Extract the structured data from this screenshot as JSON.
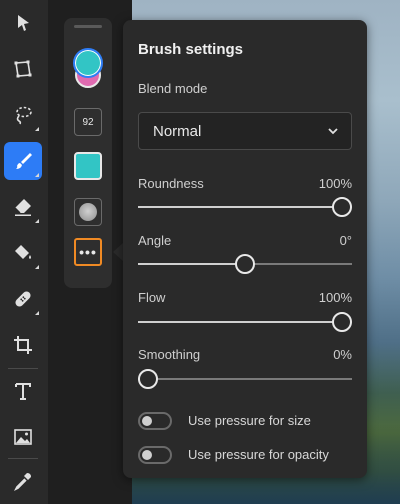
{
  "tool_rail": {
    "tools": [
      {
        "name": "select-tool",
        "icon": "arrow-pointer-icon"
      },
      {
        "name": "transform-tool",
        "icon": "transform-icon"
      },
      {
        "name": "lasso-tool",
        "icon": "lasso-icon"
      },
      {
        "name": "brush-tool",
        "icon": "brush-icon",
        "active": true
      },
      {
        "name": "eraser-tool",
        "icon": "eraser-icon"
      },
      {
        "name": "fill-tool",
        "icon": "paint-bucket-icon"
      },
      {
        "name": "healing-tool",
        "icon": "bandage-icon"
      },
      {
        "name": "crop-tool",
        "icon": "crop-icon"
      },
      {
        "name": "type-tool",
        "icon": "text-icon"
      },
      {
        "name": "image-tool",
        "icon": "image-icon"
      },
      {
        "name": "eyedropper-tool",
        "icon": "eyedropper-icon"
      }
    ],
    "active_color": "#2d7cf6"
  },
  "options": {
    "brush_size": "92",
    "primary_color": "#32c5c5",
    "secondary_color": "#e06ab0",
    "more_icon_text": "•••",
    "highlight_color": "#f08a24"
  },
  "brush_settings": {
    "title": "Brush settings",
    "blend_mode_label": "Blend mode",
    "blend_mode_value": "Normal",
    "roundness": {
      "label": "Roundness",
      "value_text": "100%",
      "value": 100
    },
    "angle": {
      "label": "Angle",
      "value_text": "0°",
      "value": 0,
      "min": -180,
      "max": 180
    },
    "flow": {
      "label": "Flow",
      "value_text": "100%",
      "value": 100
    },
    "smoothing": {
      "label": "Smoothing",
      "value_text": "0%",
      "value": 0
    },
    "pressure_size": {
      "label": "Use pressure for size",
      "on": false
    },
    "pressure_opacity": {
      "label": "Use pressure for opacity",
      "on": false
    }
  }
}
